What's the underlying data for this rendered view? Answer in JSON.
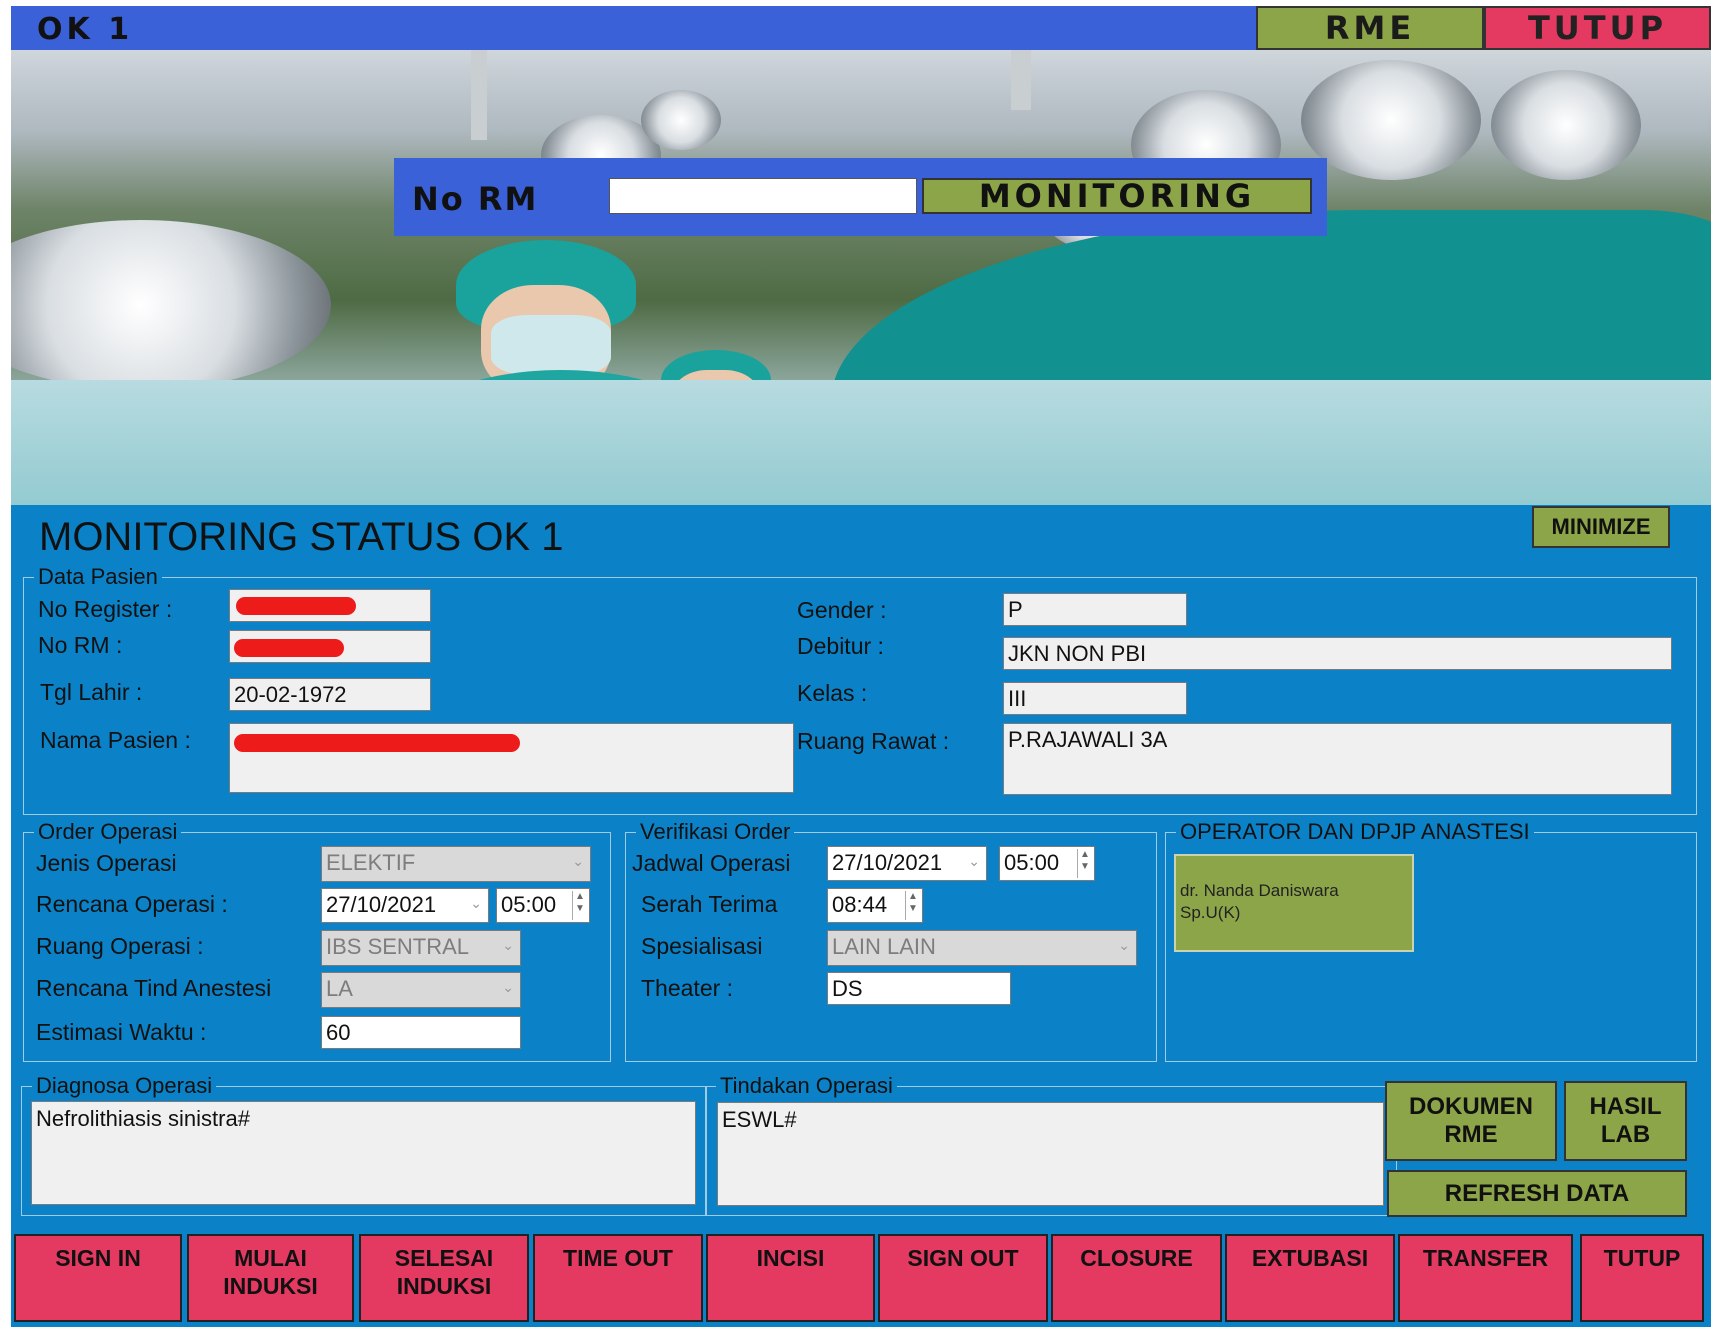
{
  "window": {
    "title": "OK 1",
    "rme_label": "RME",
    "close_label": "TUTUP"
  },
  "search": {
    "label": "No RM",
    "value": "",
    "button_label": "MONITORING"
  },
  "panel": {
    "title": "MONITORING STATUS OK 1",
    "minimize_label": "MINIMIZE"
  },
  "patient": {
    "group_title": "Data Pasien",
    "no_register_label": "No Register :",
    "no_rm_label": "No RM :",
    "tgl_lahir_label": "Tgl Lahir :",
    "tgl_lahir": "20-02-1972",
    "nama_label": "Nama Pasien :",
    "gender_label": "Gender :",
    "gender": "P",
    "debitur_label": "Debitur :",
    "debitur": "JKN NON PBI",
    "kelas_label": "Kelas :",
    "kelas": "III",
    "ruang_label": "Ruang Rawat :",
    "ruang": "P.RAJAWALI 3A"
  },
  "order": {
    "group_title": "Order Operasi",
    "jenis_label": "Jenis Operasi",
    "jenis": "ELEKTIF",
    "rencana_label": "Rencana Operasi :",
    "rencana_date": "27/10/2021",
    "rencana_time": "05:00",
    "ruang_label": "Ruang Operasi :",
    "ruang": "IBS SENTRAL",
    "anestesi_label": "Rencana Tind Anestesi",
    "anestesi": "LA",
    "estimasi_label": "Estimasi Waktu :",
    "estimasi": "60"
  },
  "verifikasi": {
    "group_title": "Verifikasi Order",
    "jadwal_label": "Jadwal Operasi",
    "jadwal_date": "27/10/2021",
    "jadwal_time": "05:00",
    "serah_label": "Serah Terima",
    "serah_time": "08:44",
    "spesialisasi_label": "Spesialisasi",
    "spesialisasi": "LAIN LAIN",
    "theater_label": "Theater :",
    "theater": "DS"
  },
  "operator": {
    "group_title": "OPERATOR DAN DPJP ANASTESI",
    "card_line1": "dr. Nanda Daniswara",
    "card_line2": "Sp.U(K)"
  },
  "diagnosa": {
    "group_title": "Diagnosa Operasi",
    "value": "Nefrolithiasis sinistra#"
  },
  "tindakan": {
    "group_title": "Tindakan Operasi",
    "value": "ESWL#"
  },
  "side_buttons": {
    "dokumen_rme": "DOKUMEN\nRME",
    "hasil_lab": "HASIL\nLAB",
    "refresh": "REFRESH DATA"
  },
  "actions": [
    "SIGN IN",
    "MULAI\nINDUKSI",
    "SELESAI\nINDUKSI",
    "TIME OUT",
    "INCISI",
    "SIGN OUT",
    "CLOSURE",
    "EXTUBASI",
    "TRANSFER",
    "TUTUP"
  ],
  "colors": {
    "title_blue": "#3a61d8",
    "panel_blue": "#0b82c7",
    "olive_green": "#8da549",
    "action_red": "#e43a62"
  }
}
